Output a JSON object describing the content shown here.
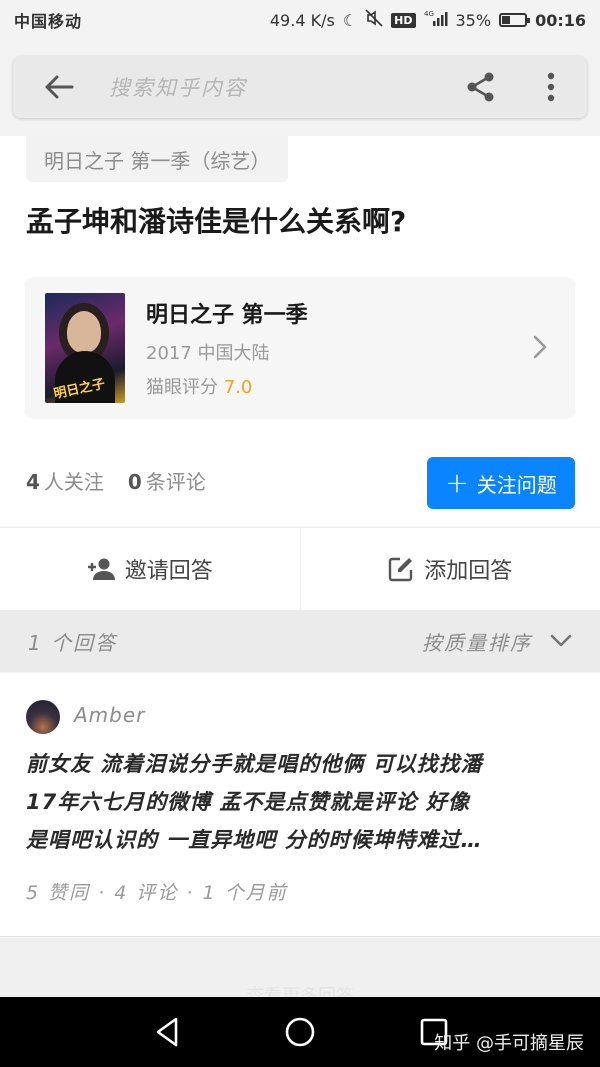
{
  "status_bar": {
    "carrier": "中国移动",
    "speed": "49.4 K/s",
    "network": "4G",
    "hd": "HD",
    "battery_percent": "35%",
    "battery_level": 0.35,
    "time": "00:16"
  },
  "search": {
    "placeholder": "搜索知乎内容"
  },
  "question": {
    "tag": "明日之子 第一季（综艺）",
    "title": "孟子坤和潘诗佳是什么关系啊?"
  },
  "movie": {
    "title": "明日之子 第一季",
    "meta": "2017 中国大陆",
    "rating_label": "猫眼评分",
    "rating_value": "7.0",
    "poster_text": "明日之子"
  },
  "stats": {
    "followers_count": "4",
    "followers_label": "人关注",
    "comments_count": "0",
    "comments_label": "条评论"
  },
  "follow_button": {
    "label": "关注问题"
  },
  "actions": {
    "invite_label": "邀请回答",
    "add_label": "添加回答"
  },
  "answers_header": {
    "count_label": "1 个回答",
    "sort_label": "按质量排序"
  },
  "answer": {
    "author": "Amber",
    "lines": [
      "前女友 流着泪说分手就是唱的他俩 可以找找潘",
      "17年六七月的微博 孟不是点赞就是评论 好像",
      "是唱吧认识的 一直异地吧 分的时候坤特难过…"
    ],
    "meta": "5 赞同 · 4 评论 · 1 个月前"
  },
  "next_section": {
    "faded_text": "查看更多回答"
  },
  "watermark": "知乎 @手可摘星辰",
  "colors": {
    "accent": "#0a84ff",
    "rating": "#f4a21d"
  }
}
